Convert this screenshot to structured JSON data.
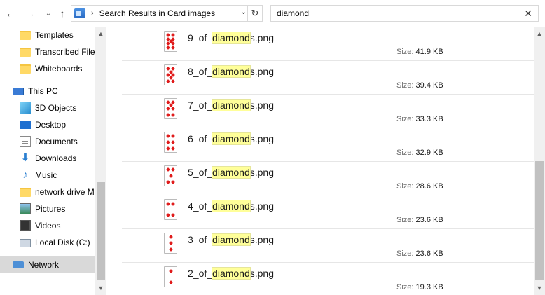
{
  "toolbar": {
    "back_icon": "arrow-left-icon",
    "forward_icon": "arrow-right-icon",
    "recent_icon": "chevron-down-icon",
    "up_icon": "arrow-up-icon"
  },
  "address": {
    "path": "Search Results in Card images",
    "separator": "›",
    "dropdown": "⌄",
    "refresh": "↻"
  },
  "search": {
    "value": "diamond",
    "clear": "✕"
  },
  "sidebar": {
    "items": [
      {
        "label": "Templates",
        "icon": "folder-icon"
      },
      {
        "label": "Transcribed Files",
        "icon": "folder-icon"
      },
      {
        "label": "Whiteboards",
        "icon": "folder-icon"
      },
      {
        "label": "This PC",
        "icon": "computer-icon"
      },
      {
        "label": "3D Objects",
        "icon": "cube-icon"
      },
      {
        "label": "Desktop",
        "icon": "desktop-icon"
      },
      {
        "label": "Documents",
        "icon": "document-icon"
      },
      {
        "label": "Downloads",
        "icon": "download-icon"
      },
      {
        "label": "Music",
        "icon": "music-icon"
      },
      {
        "label": "network drive M",
        "icon": "folder-icon"
      },
      {
        "label": "Pictures",
        "icon": "picture-icon"
      },
      {
        "label": "Videos",
        "icon": "video-icon"
      },
      {
        "label": "Local Disk (C:)",
        "icon": "disk-icon"
      },
      {
        "label": "Network",
        "icon": "network-icon"
      }
    ],
    "selected": "Network"
  },
  "files": [
    {
      "prefix": "9_of_",
      "match": "diamond",
      "suffix": "s.png",
      "size_label": "Size:",
      "size": "41.9 KB",
      "rank": 9
    },
    {
      "prefix": "8_of_",
      "match": "diamond",
      "suffix": "s.png",
      "size_label": "Size:",
      "size": "39.4 KB",
      "rank": 8
    },
    {
      "prefix": "7_of_",
      "match": "diamond",
      "suffix": "s.png",
      "size_label": "Size:",
      "size": "33.3 KB",
      "rank": 7
    },
    {
      "prefix": "6_of_",
      "match": "diamond",
      "suffix": "s.png",
      "size_label": "Size:",
      "size": "32.9 KB",
      "rank": 6
    },
    {
      "prefix": "5_of_",
      "match": "diamond",
      "suffix": "s.png",
      "size_label": "Size:",
      "size": "28.6 KB",
      "rank": 5
    },
    {
      "prefix": "4_of_",
      "match": "diamond",
      "suffix": "s.png",
      "size_label": "Size:",
      "size": "23.6 KB",
      "rank": 4
    },
    {
      "prefix": "3_of_",
      "match": "diamond",
      "suffix": "s.png",
      "size_label": "Size:",
      "size": "23.6 KB",
      "rank": 3
    },
    {
      "prefix": "2_of_",
      "match": "diamond",
      "suffix": "s.png",
      "size_label": "Size:",
      "size": "19.3 KB",
      "rank": 2
    }
  ],
  "colors": {
    "highlight": "#ffff99",
    "suit": "#e01b1b",
    "selection": "#d9d9d9"
  }
}
